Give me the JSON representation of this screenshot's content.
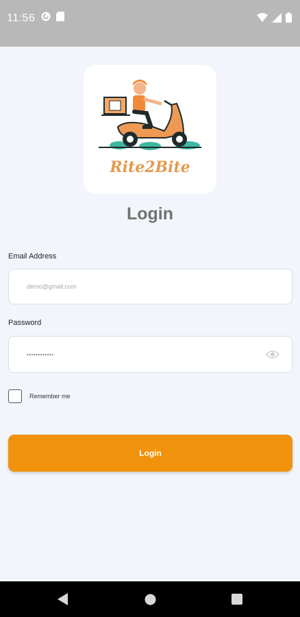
{
  "status_bar": {
    "time": "11:56",
    "icons": [
      "pocket-casts-icon",
      "sim-card-icon",
      "wifi-icon",
      "signal-icon",
      "battery-icon"
    ]
  },
  "brand": {
    "name": "Rite2Bite",
    "logo": "delivery-scooter-icon",
    "color": "#e39a4f"
  },
  "page": {
    "title": "Login"
  },
  "email": {
    "label": "Email Address",
    "placeholder": "demo@gmail.com"
  },
  "password": {
    "label": "Password",
    "value": "••••••••••••",
    "toggle_icon": "eye-icon"
  },
  "remember": {
    "label": "Remember me",
    "checked": false
  },
  "login_button": {
    "label": "Login",
    "color": "#f0920c"
  },
  "nav_bar": {
    "icons": [
      "back-icon",
      "home-icon",
      "recents-icon"
    ]
  }
}
